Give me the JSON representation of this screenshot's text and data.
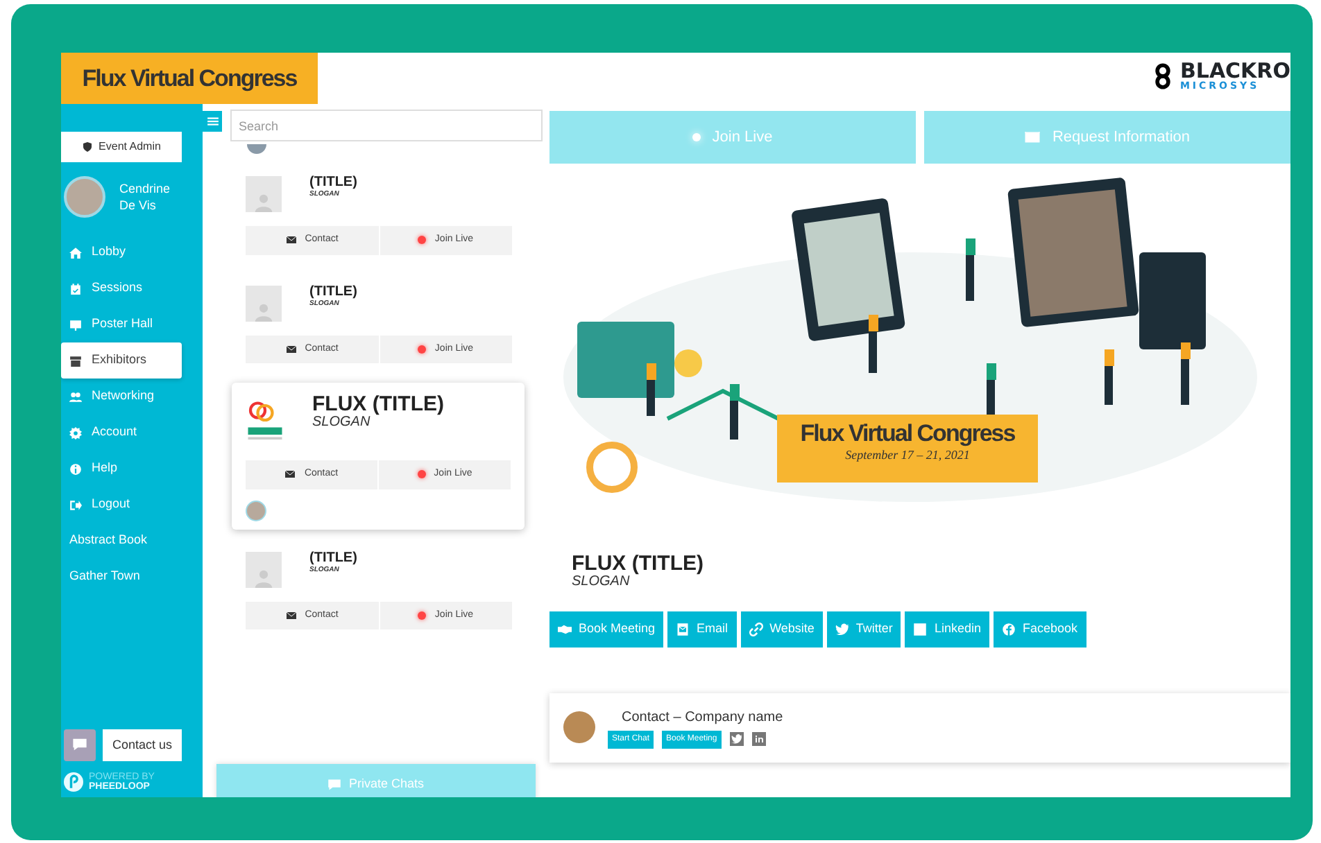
{
  "header": {
    "logo_title": "Flux Virtual Congress",
    "sponsor_logo_line_1": "BLACKRO",
    "sponsor_logo_line_2": "MICROSYS"
  },
  "sidebar": {
    "admin_button": "Event Admin",
    "user_name": "Cendrine De Vis",
    "items": [
      {
        "label": "Lobby",
        "selected": false
      },
      {
        "label": "Sessions",
        "selected": false
      },
      {
        "label": "Poster Hall",
        "selected": false
      },
      {
        "label": "Exhibitors",
        "selected": true
      },
      {
        "label": "Networking",
        "selected": false
      },
      {
        "label": "Account",
        "selected": false
      },
      {
        "label": "Help",
        "selected": false
      },
      {
        "label": "Logout",
        "selected": false
      },
      {
        "label": "Abstract Book",
        "selected": false
      },
      {
        "label": "Gather Town",
        "selected": false
      }
    ],
    "contact_button": "Contact us",
    "powered_by": "POWERED BY",
    "powered_brand": "PHEEDLOOP"
  },
  "exhibitor_list": {
    "search": {
      "placeholder": "Search"
    },
    "items": [
      {
        "title": "(TITLE)",
        "slogan": "SLOGAN",
        "selected": false,
        "contact": "Contact",
        "join": "Join Live"
      },
      {
        "title": "(TITLE)",
        "slogan": "SLOGAN",
        "selected": false,
        "contact": "Contact",
        "join": "Join Live"
      },
      {
        "title": "FLUX (TITLE)",
        "slogan": "SLOGAN",
        "selected": true,
        "contact": "Contact",
        "join": "Join Live"
      },
      {
        "title": "(TITLE)",
        "slogan": "SLOGAN",
        "selected": false,
        "contact": "Contact",
        "join": "Join Live"
      }
    ],
    "private_chats": "Private Chats"
  },
  "exhibitor": {
    "actions": [
      "Join Live",
      "Request Information"
    ],
    "banner": {
      "title": "Flux Virtual Congress",
      "dates": "September 17 – 21, 2021"
    },
    "title": "FLUX (TITLE)",
    "slogan": "SLOGAN",
    "links": [
      "Book Meeting",
      "Email",
      "Website",
      "Twitter",
      "Linkedin",
      "Facebook"
    ],
    "contact": {
      "name": "Contact – Company name",
      "buttons": [
        "Start Chat",
        "Book Meeting"
      ]
    }
  }
}
